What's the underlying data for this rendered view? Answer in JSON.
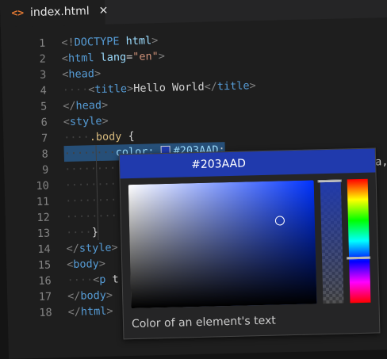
{
  "tab": {
    "icon": "<>",
    "label": "index.html",
    "close": "✕"
  },
  "lines": [
    {
      "n": "1",
      "parts": [
        {
          "c": "punct",
          "t": "<!"
        },
        {
          "c": "tag",
          "t": "DOCTYPE"
        },
        {
          "c": "plain",
          "t": " "
        },
        {
          "c": "attr",
          "t": "html"
        },
        {
          "c": "punct",
          "t": ">"
        }
      ]
    },
    {
      "n": "2",
      "parts": [
        {
          "c": "punct",
          "t": "<"
        },
        {
          "c": "tag",
          "t": "html"
        },
        {
          "c": "plain",
          "t": " "
        },
        {
          "c": "attr",
          "t": "lang"
        },
        {
          "c": "plain",
          "t": "="
        },
        {
          "c": "str",
          "t": "\"en\""
        },
        {
          "c": "punct",
          "t": ">"
        }
      ]
    },
    {
      "n": "3",
      "parts": [
        {
          "c": "punct",
          "t": "<"
        },
        {
          "c": "tag",
          "t": "head"
        },
        {
          "c": "punct",
          "t": ">"
        }
      ]
    },
    {
      "n": "4",
      "parts": [
        {
          "c": "ind",
          "t": "····"
        },
        {
          "c": "punct",
          "t": "<"
        },
        {
          "c": "tag",
          "t": "title"
        },
        {
          "c": "punct",
          "t": ">"
        },
        {
          "c": "plain",
          "t": "Hello World"
        },
        {
          "c": "punct",
          "t": "</"
        },
        {
          "c": "tag",
          "t": "title"
        },
        {
          "c": "punct",
          "t": ">"
        }
      ]
    },
    {
      "n": "5",
      "parts": [
        {
          "c": "punct",
          "t": "</"
        },
        {
          "c": "tag",
          "t": "head"
        },
        {
          "c": "punct",
          "t": ">"
        }
      ]
    },
    {
      "n": "6",
      "parts": [
        {
          "c": "punct",
          "t": "<"
        },
        {
          "c": "tag",
          "t": "style"
        },
        {
          "c": "punct",
          "t": ">"
        }
      ]
    },
    {
      "n": "7",
      "parts": [
        {
          "c": "ind",
          "t": "····"
        },
        {
          "c": "sel",
          "t": ".body"
        },
        {
          "c": "plain",
          "t": " {"
        }
      ]
    },
    {
      "n": "8",
      "parts": [
        {
          "c": "ind",
          "t": "········"
        },
        {
          "c": "prop",
          "t": "color:"
        },
        {
          "c": "plain",
          "t": " "
        },
        {
          "c": "swatch",
          "t": ""
        },
        {
          "c": "colorval",
          "t": "#203AAD"
        },
        {
          "c": "plain",
          "t": ";"
        }
      ]
    },
    {
      "n": "9",
      "parts": [
        {
          "c": "ind",
          "t": "········"
        }
      ]
    },
    {
      "n": "10",
      "parts": [
        {
          "c": "ind",
          "t": "········"
        }
      ]
    },
    {
      "n": "11",
      "parts": [
        {
          "c": "ind",
          "t": "········"
        }
      ]
    },
    {
      "n": "12",
      "parts": [
        {
          "c": "ind",
          "t": "········"
        }
      ]
    },
    {
      "n": "13",
      "parts": [
        {
          "c": "ind",
          "t": "····"
        },
        {
          "c": "plain",
          "t": "}"
        }
      ]
    },
    {
      "n": "14",
      "parts": [
        {
          "c": "punct",
          "t": "</"
        },
        {
          "c": "tag",
          "t": "style"
        },
        {
          "c": "punct",
          "t": ">"
        }
      ]
    },
    {
      "n": "15",
      "parts": [
        {
          "c": "punct",
          "t": "<"
        },
        {
          "c": "tag",
          "t": "body"
        },
        {
          "c": "punct",
          "t": ">"
        }
      ]
    },
    {
      "n": "16",
      "parts": [
        {
          "c": "ind",
          "t": "····"
        },
        {
          "c": "punct",
          "t": "<"
        },
        {
          "c": "tag",
          "t": "p"
        },
        {
          "c": "plain",
          "t": " t"
        }
      ]
    },
    {
      "n": "17",
      "parts": [
        {
          "c": "punct",
          "t": "</"
        },
        {
          "c": "tag",
          "t": "body"
        },
        {
          "c": "punct",
          "t": ">"
        }
      ]
    },
    {
      "n": "18",
      "parts": [
        {
          "c": "punct",
          "t": "</"
        },
        {
          "c": "tag",
          "t": "html"
        },
        {
          "c": "punct",
          "t": ">"
        }
      ]
    }
  ],
  "line9_tail": "a,",
  "picker": {
    "value": "#203AAD",
    "hue_color": "#0033ff",
    "saturation": 0.81,
    "brightness": 0.68,
    "hue_level": 0.63,
    "opacity_level": 0.0,
    "hint": "Color of an element's text"
  },
  "colors": {
    "editor_bg": "#1e1e1e",
    "picker_header_bg": "#203AAD",
    "swatch": "#203AAD"
  }
}
